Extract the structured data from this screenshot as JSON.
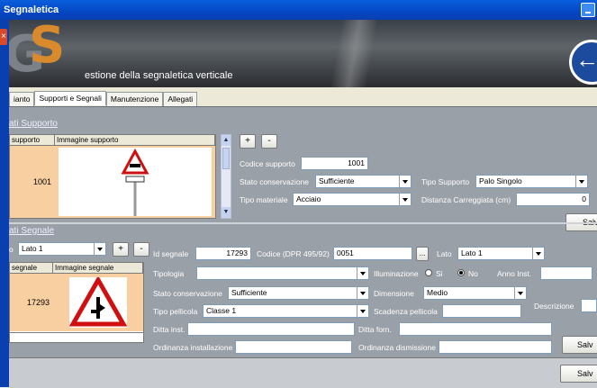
{
  "window": {
    "title": "Segnaletica"
  },
  "banner": {
    "caption": "estione della segnaletica verticale"
  },
  "tabs": [
    {
      "label": "ianto"
    },
    {
      "label": "Supporti e Segnali"
    },
    {
      "label": "Manutenzione"
    },
    {
      "label": "Allegati"
    }
  ],
  "supporto": {
    "section_label": "ati Supporto",
    "grid": {
      "col1": "supporto",
      "col2": "Immagine supporto",
      "row_id": "1001"
    },
    "add_label": "+",
    "remove_label": "-",
    "codice_label": "Codice supporto",
    "codice_value": "1001",
    "stato_label": "Stato conservazione",
    "stato_value": "Sufficiente",
    "tipo_supporto_label": "Tipo Supporto",
    "tipo_supporto_value": "Palo Singolo",
    "materiale_label": "Tipo materiale",
    "materiale_value": "Acciaio",
    "distanza_label": "Distanza Carreggiata (cm)",
    "distanza_value": "0",
    "save_label": "Salv"
  },
  "segnale": {
    "section_label": "ati Segnale",
    "lato_prefix": "o",
    "lato_select": "Lato 1",
    "add_label": "+",
    "remove_label": "-",
    "grid": {
      "col1": "segnale",
      "col2": "Immagine segnale",
      "row_id": "17293"
    },
    "id_label": "Id segnale",
    "id_value": "17293",
    "codice_label": "Codice (DPR 495/92)",
    "codice_value": "0051",
    "browse_label": "...",
    "lato_label": "Lato",
    "lato_value": "Lato 1",
    "tipologia_label": "Tipologia",
    "tipologia_value": "",
    "illuminazione_label": "Illuminazione",
    "si_label": "Si",
    "no_label": "No",
    "anno_label": "Anno Inst.",
    "anno_value": "",
    "stato_label": "Stato conservazione",
    "stato_value": "Sufficiente",
    "dimensione_label": "Dimensione",
    "dimensione_value": "Medio",
    "descrizione_label": "Descrizione",
    "pellicola_label": "Tipo pellicola",
    "pellicola_value": "Classe 1",
    "scadenza_label": "Scadenza pellicola",
    "scadenza_value": "",
    "ditta_inst_label": "Ditta inst.",
    "ditta_inst_value": "",
    "ditta_forn_label": "Ditta forn.",
    "ditta_forn_value": "",
    "ord_inst_label": "Ordinanza installazione",
    "ord_inst_value": "",
    "ord_dism_label": "Ordinanza dismissione",
    "ord_dism_value": "",
    "save_label": "Salv"
  },
  "footer": {
    "save_label": "Salv"
  },
  "colors": {
    "title_bar": "#0546c4",
    "panel": "#9aa0a8",
    "row_highlight": "#f8cfa0"
  }
}
